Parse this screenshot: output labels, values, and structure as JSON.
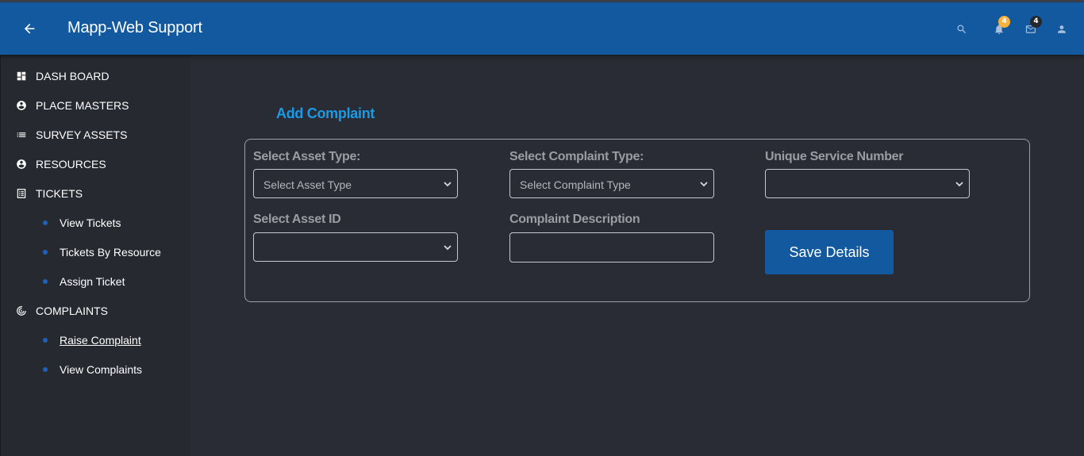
{
  "app": {
    "title": "Mapp-Web Support"
  },
  "topbar": {
    "icons": {
      "back": "arrow-left-icon",
      "search": "search-icon",
      "notifications": "bell-icon",
      "mail": "mail-icon",
      "profile": "user-icon"
    },
    "notification_count": "4",
    "mail_count": "4"
  },
  "sidebar": {
    "items": [
      {
        "label": "DASH BOARD",
        "icon": "dashboard-icon"
      },
      {
        "label": "PLACE MASTERS",
        "icon": "account-circle-icon"
      },
      {
        "label": "SURVEY ASSETS",
        "icon": "list-icon"
      },
      {
        "label": "RESOURCES",
        "icon": "account-circle-icon"
      },
      {
        "label": "TICKETS",
        "icon": "receipt-list-icon"
      },
      {
        "label": "COMPLAINTS",
        "icon": "radar-icon"
      }
    ],
    "ticket_subitems": [
      "View Tickets",
      "Tickets By Resource",
      "Assign Ticket"
    ],
    "complaint_subitems": [
      "Raise Complaint",
      "View Complaints"
    ],
    "active_subitem": "Raise Complaint"
  },
  "main": {
    "heading": "Add Complaint",
    "form": {
      "asset_type_label": "Select Asset Type:",
      "asset_type_value": "Select Asset Type",
      "complaint_type_label": "Select Complaint Type:",
      "complaint_type_value": "Select Complaint Type",
      "service_number_label": "Unique Service Number",
      "service_number_value": "",
      "asset_id_label": "Select Asset ID",
      "asset_id_value": "",
      "description_label": "Complaint Description",
      "description_value": "",
      "save_label": "Save Details"
    }
  },
  "colors": {
    "appbar": "#1259a0",
    "background": "#292c34",
    "sidebar": "#262930",
    "accent_heading": "#1a9be6",
    "notification_badge": "#f6b23c",
    "bullet": "#1d62b8"
  }
}
